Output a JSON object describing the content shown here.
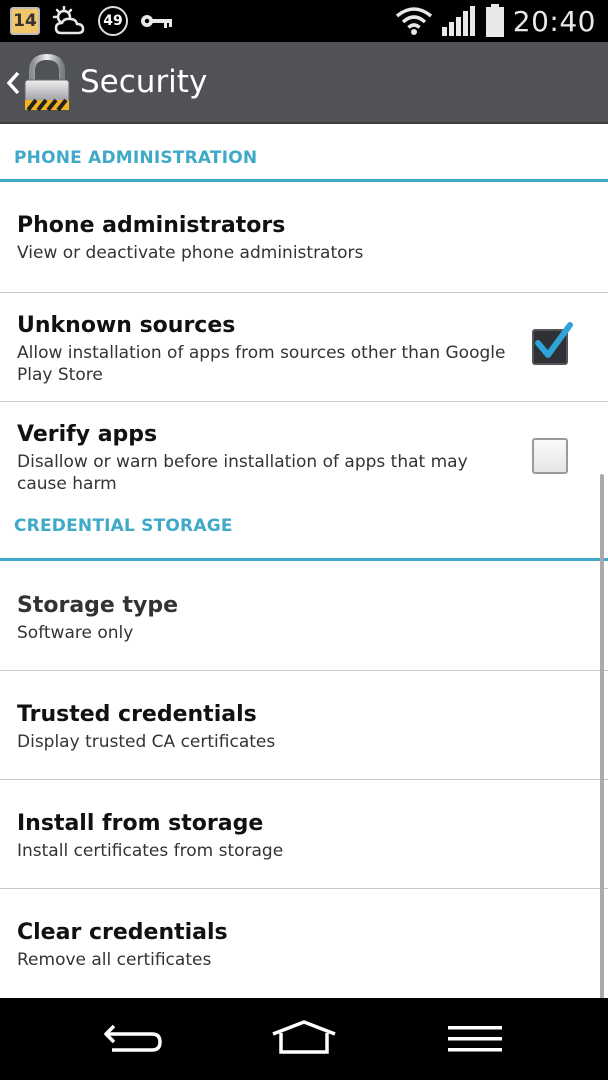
{
  "status_bar": {
    "calendar_day": "14",
    "temperature": "49",
    "time": "20:40",
    "icons": [
      "calendar-icon",
      "weather-icon",
      "temperature-icon",
      "key-icon",
      "wifi-icon",
      "signal-icon",
      "battery-icon"
    ]
  },
  "action_bar": {
    "title": "Security",
    "icons": [
      "back-chevron-icon",
      "lock-icon"
    ]
  },
  "sections": {
    "phone_admin": {
      "header": "PHONE ADMINISTRATION",
      "items": [
        {
          "title": "Phone administrators",
          "summary": "View or deactivate phone administrators"
        },
        {
          "title": "Unknown sources",
          "summary": "Allow installation of apps from sources other than Google Play Store",
          "checked": true
        },
        {
          "title": "Verify apps",
          "summary": "Disallow or warn before installation of apps that may cause harm",
          "checked": false
        }
      ]
    },
    "credential_storage": {
      "header": "CREDENTIAL STORAGE",
      "items": [
        {
          "title": "Storage type",
          "summary": "Software only",
          "enabled": false
        },
        {
          "title": "Trusted credentials",
          "summary": "Display trusted CA certificates"
        },
        {
          "title": "Install from storage",
          "summary": "Install certificates from storage"
        },
        {
          "title": "Clear credentials",
          "summary": "Remove all certificates"
        }
      ]
    }
  },
  "nav_bar": {
    "icons": [
      "back-icon",
      "home-icon",
      "menu-icon"
    ]
  },
  "colors": {
    "accent": "#3fa9c8",
    "action_bar": "#505256",
    "checkmark": "#2fa4d8"
  }
}
